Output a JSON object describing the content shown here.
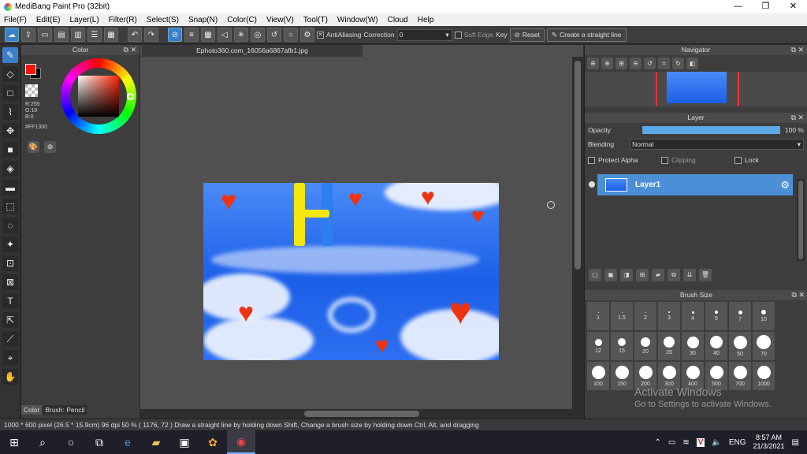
{
  "window": {
    "title": "MediBang Paint Pro (32bit)"
  },
  "menu": [
    "File(F)",
    "Edit(E)",
    "Layer(L)",
    "Filter(R)",
    "Select(S)",
    "Snap(N)",
    "Color(C)",
    "View(V)",
    "Tool(T)",
    "Window(W)",
    "Cloud",
    "Help"
  ],
  "toolbar": {
    "antialiasing": "AntiAliasing",
    "correction_label": "Correction",
    "correction_value": "0",
    "soft_edge": "Soft Edge",
    "key": "Key",
    "reset": "Reset",
    "straight_line": "Create a straight line"
  },
  "color_panel": {
    "title": "Color",
    "r": "R:255",
    "g": "G:19",
    "b": "B:0",
    "hex": "#FF1300",
    "tab_color": "Color",
    "tab_brush": "Brush: Pencil"
  },
  "document": {
    "tab": "Ephoto360.com_16056a6867afb1.jpg"
  },
  "navigator": {
    "title": "Navigator"
  },
  "layer_panel": {
    "title": "Layer",
    "opacity_label": "Opacity",
    "opacity_value": "100 %",
    "opacity_fraction": 1.0,
    "blending_label": "Blending",
    "blending_value": "Normal",
    "protect_alpha": "Protect Alpha",
    "clipping": "Clipping",
    "lock": "Lock",
    "layer_name": "Layer1"
  },
  "brush_size": {
    "title": "Brush Size",
    "sizes": [
      "1",
      "1.5",
      "2",
      "3",
      "4",
      "5",
      "7",
      "10",
      "12",
      "15",
      "20",
      "25",
      "30",
      "40",
      "50",
      "70",
      "100",
      "150",
      "200",
      "300",
      "400",
      "500",
      "700",
      "1000"
    ]
  },
  "watermark": {
    "line1": "Activate Windows",
    "line2": "Go to Settings to activate Windows."
  },
  "status": {
    "text": "1000 * 600 pixel   (26.5 * 15.9cm)   96 dpi   50 %   ( 1176, 72 )   Draw a straight line by holding down Shift, Change a brush size by holding down Ctrl, Alt, and dragging"
  },
  "taskbar": {
    "lang": "ENG",
    "time": "8:57 AM",
    "date": "21/3/2021"
  },
  "colors": {
    "accent": "#3a7fc9",
    "foreground": "#ff1300",
    "layer_selected": "#4c8fd6"
  }
}
